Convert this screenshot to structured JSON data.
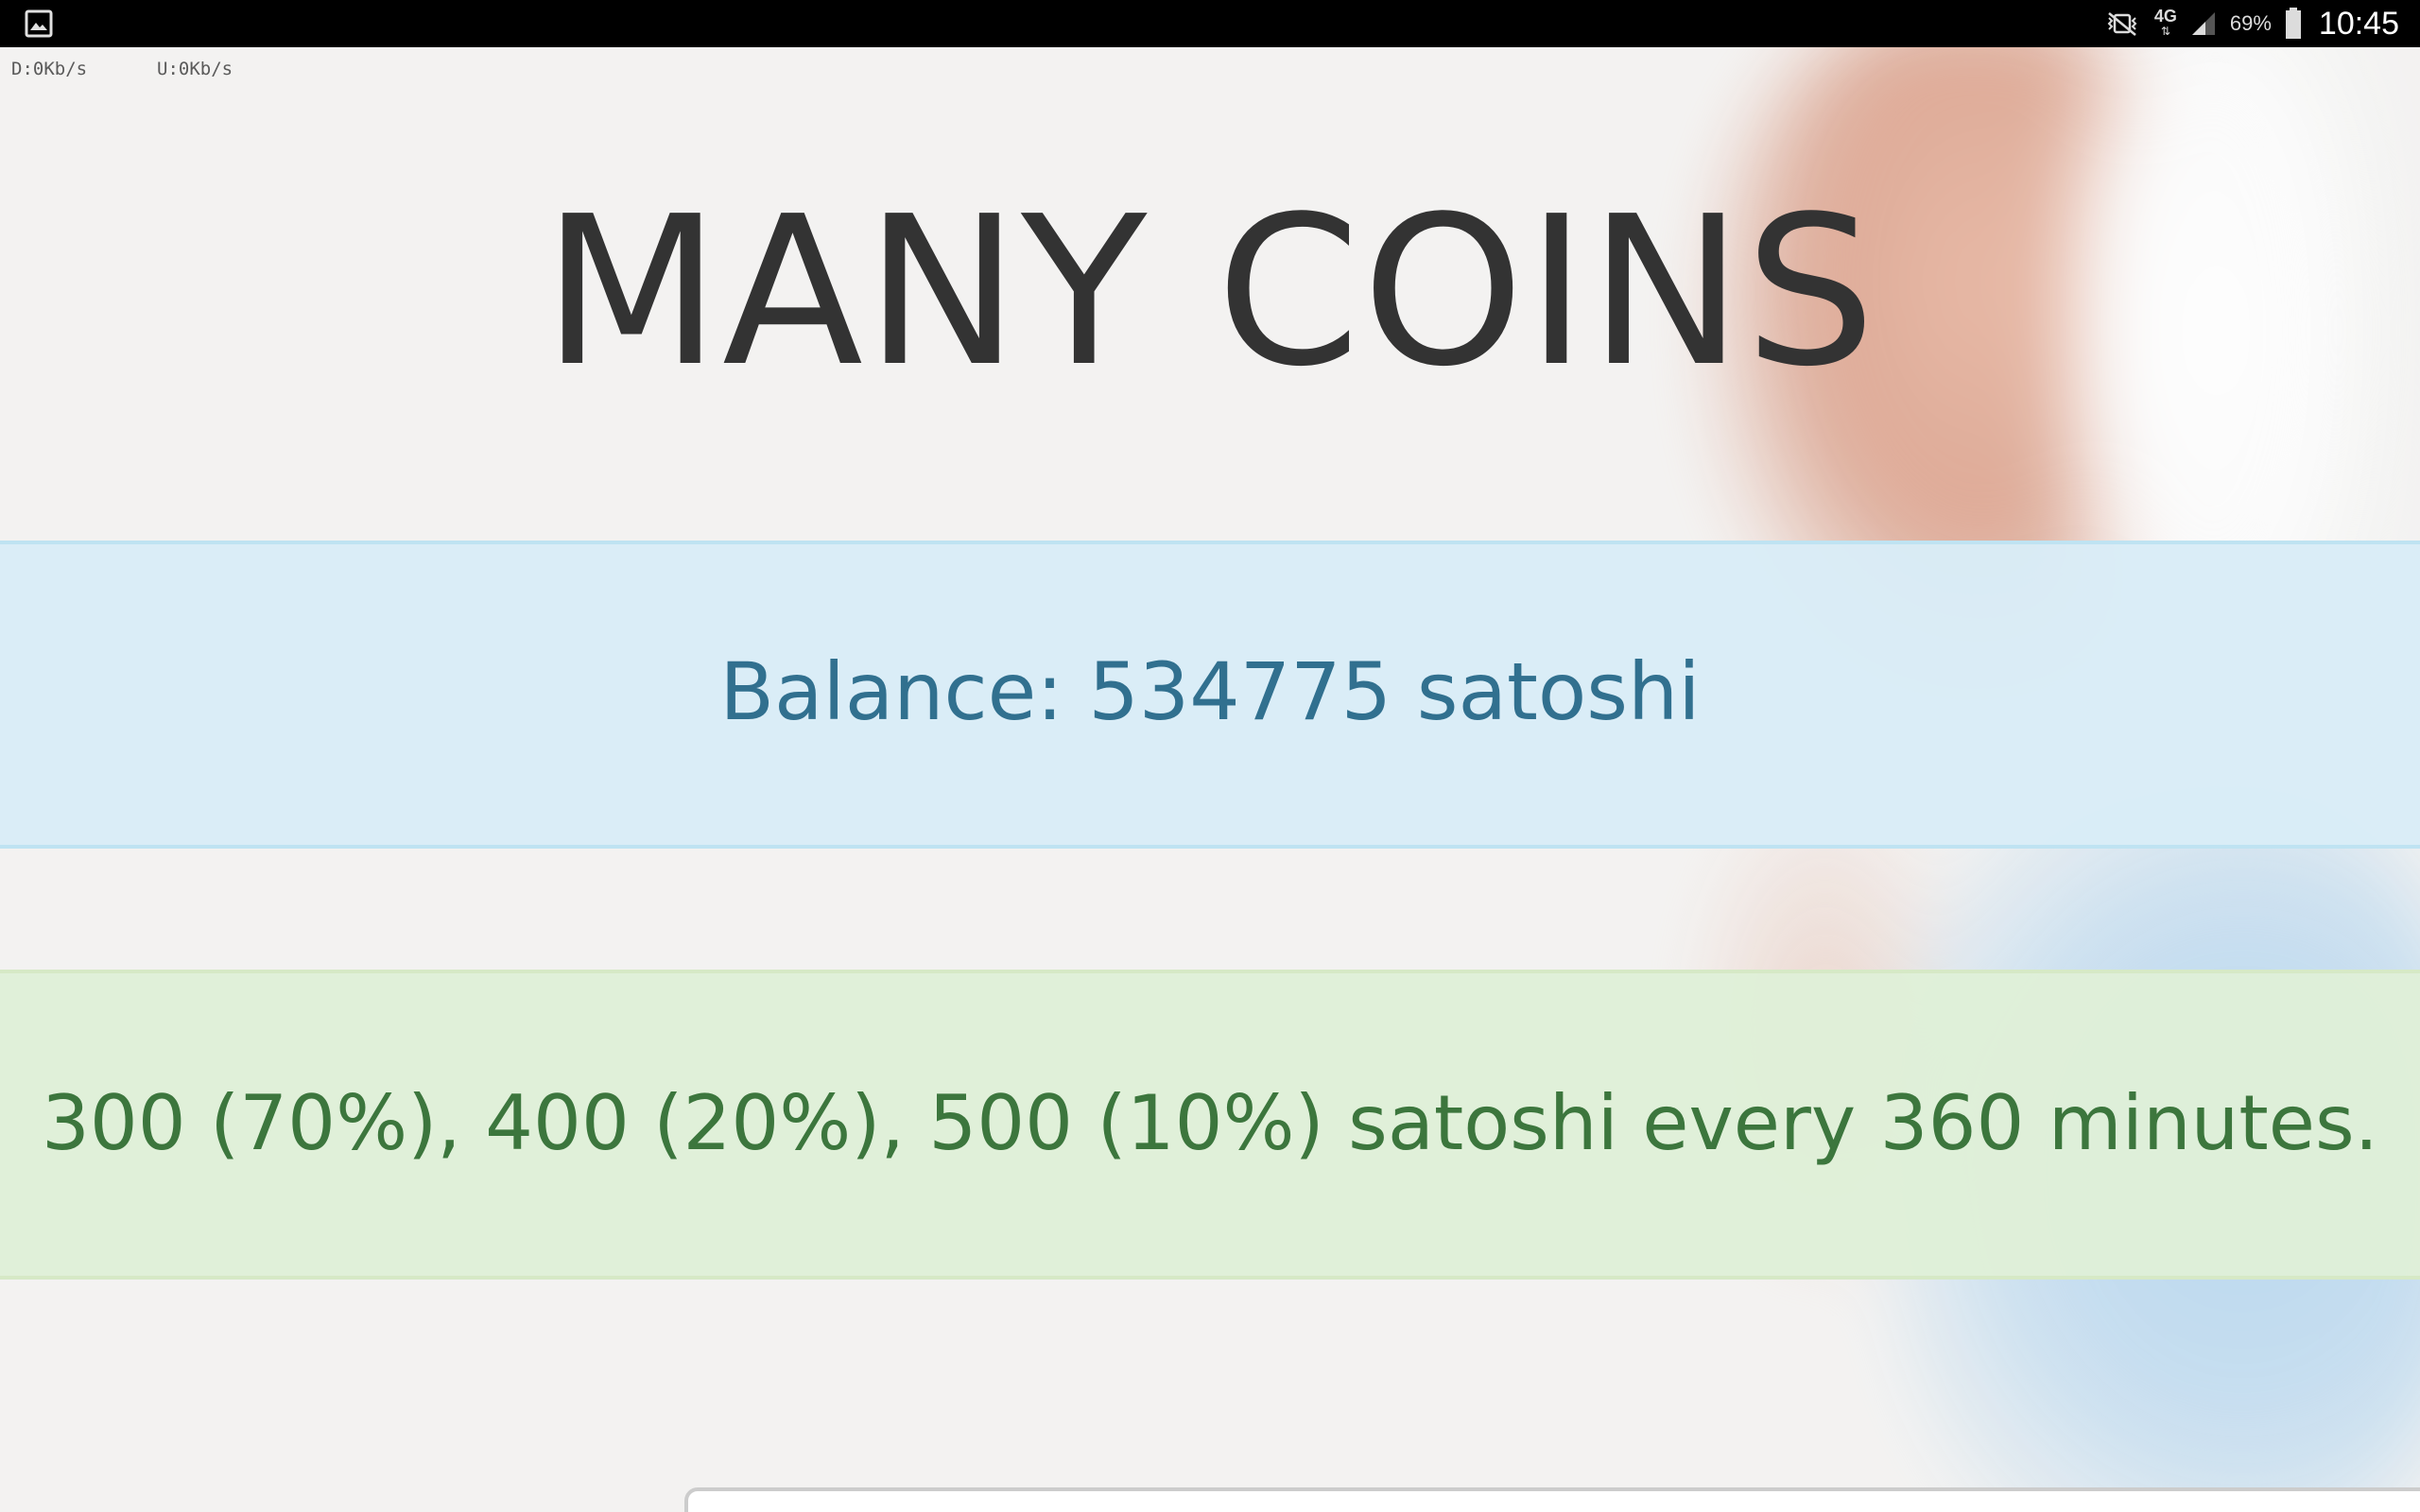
{
  "status_bar": {
    "battery_percent": "69%",
    "time": "10:45",
    "network_type": "4G",
    "icons": [
      "gallery-icon",
      "mute-vibrate-icon",
      "4g-data-icon",
      "signal-icon",
      "battery-icon"
    ]
  },
  "net_speed": {
    "download": "D:0Kb/s",
    "upload": "U:0Kb/s"
  },
  "page": {
    "title": "MANY COINS",
    "balance_text": "Balance: 534775 satoshi",
    "reward_text": "300 (70%), 400 (20%), 500 (10%) satoshi every 360 minutes."
  },
  "colors": {
    "balance_bg": "#d9ecf7",
    "balance_text": "#31708f",
    "reward_bg": "#dff0d8",
    "reward_text": "#3c763d",
    "title_text": "#333333"
  }
}
